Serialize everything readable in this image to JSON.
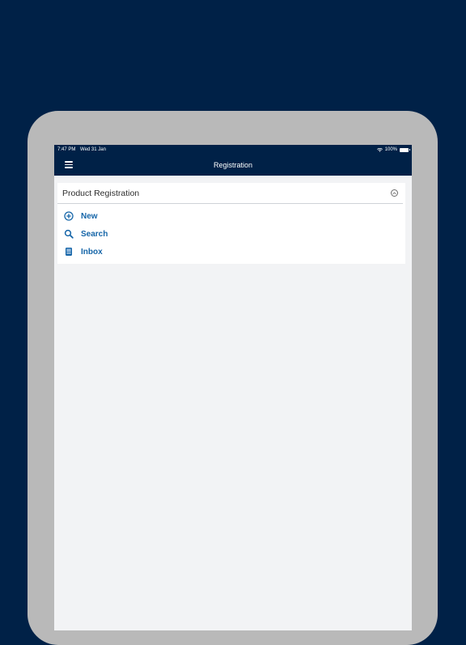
{
  "status_bar": {
    "time": "7:47 PM",
    "date": "Wed 31 Jan",
    "battery": "100%"
  },
  "nav": {
    "title": "Registration"
  },
  "section": {
    "title": "Product Registration",
    "items": [
      {
        "label": "New",
        "icon": "plus-circle-icon"
      },
      {
        "label": "Search",
        "icon": "search-icon"
      },
      {
        "label": "Inbox",
        "icon": "inbox-icon"
      }
    ]
  },
  "colors": {
    "brand_navy": "#002147",
    "link_blue": "#1565a8",
    "device_frame": "#b9b9b9",
    "screen_bg": "#f2f3f5"
  }
}
